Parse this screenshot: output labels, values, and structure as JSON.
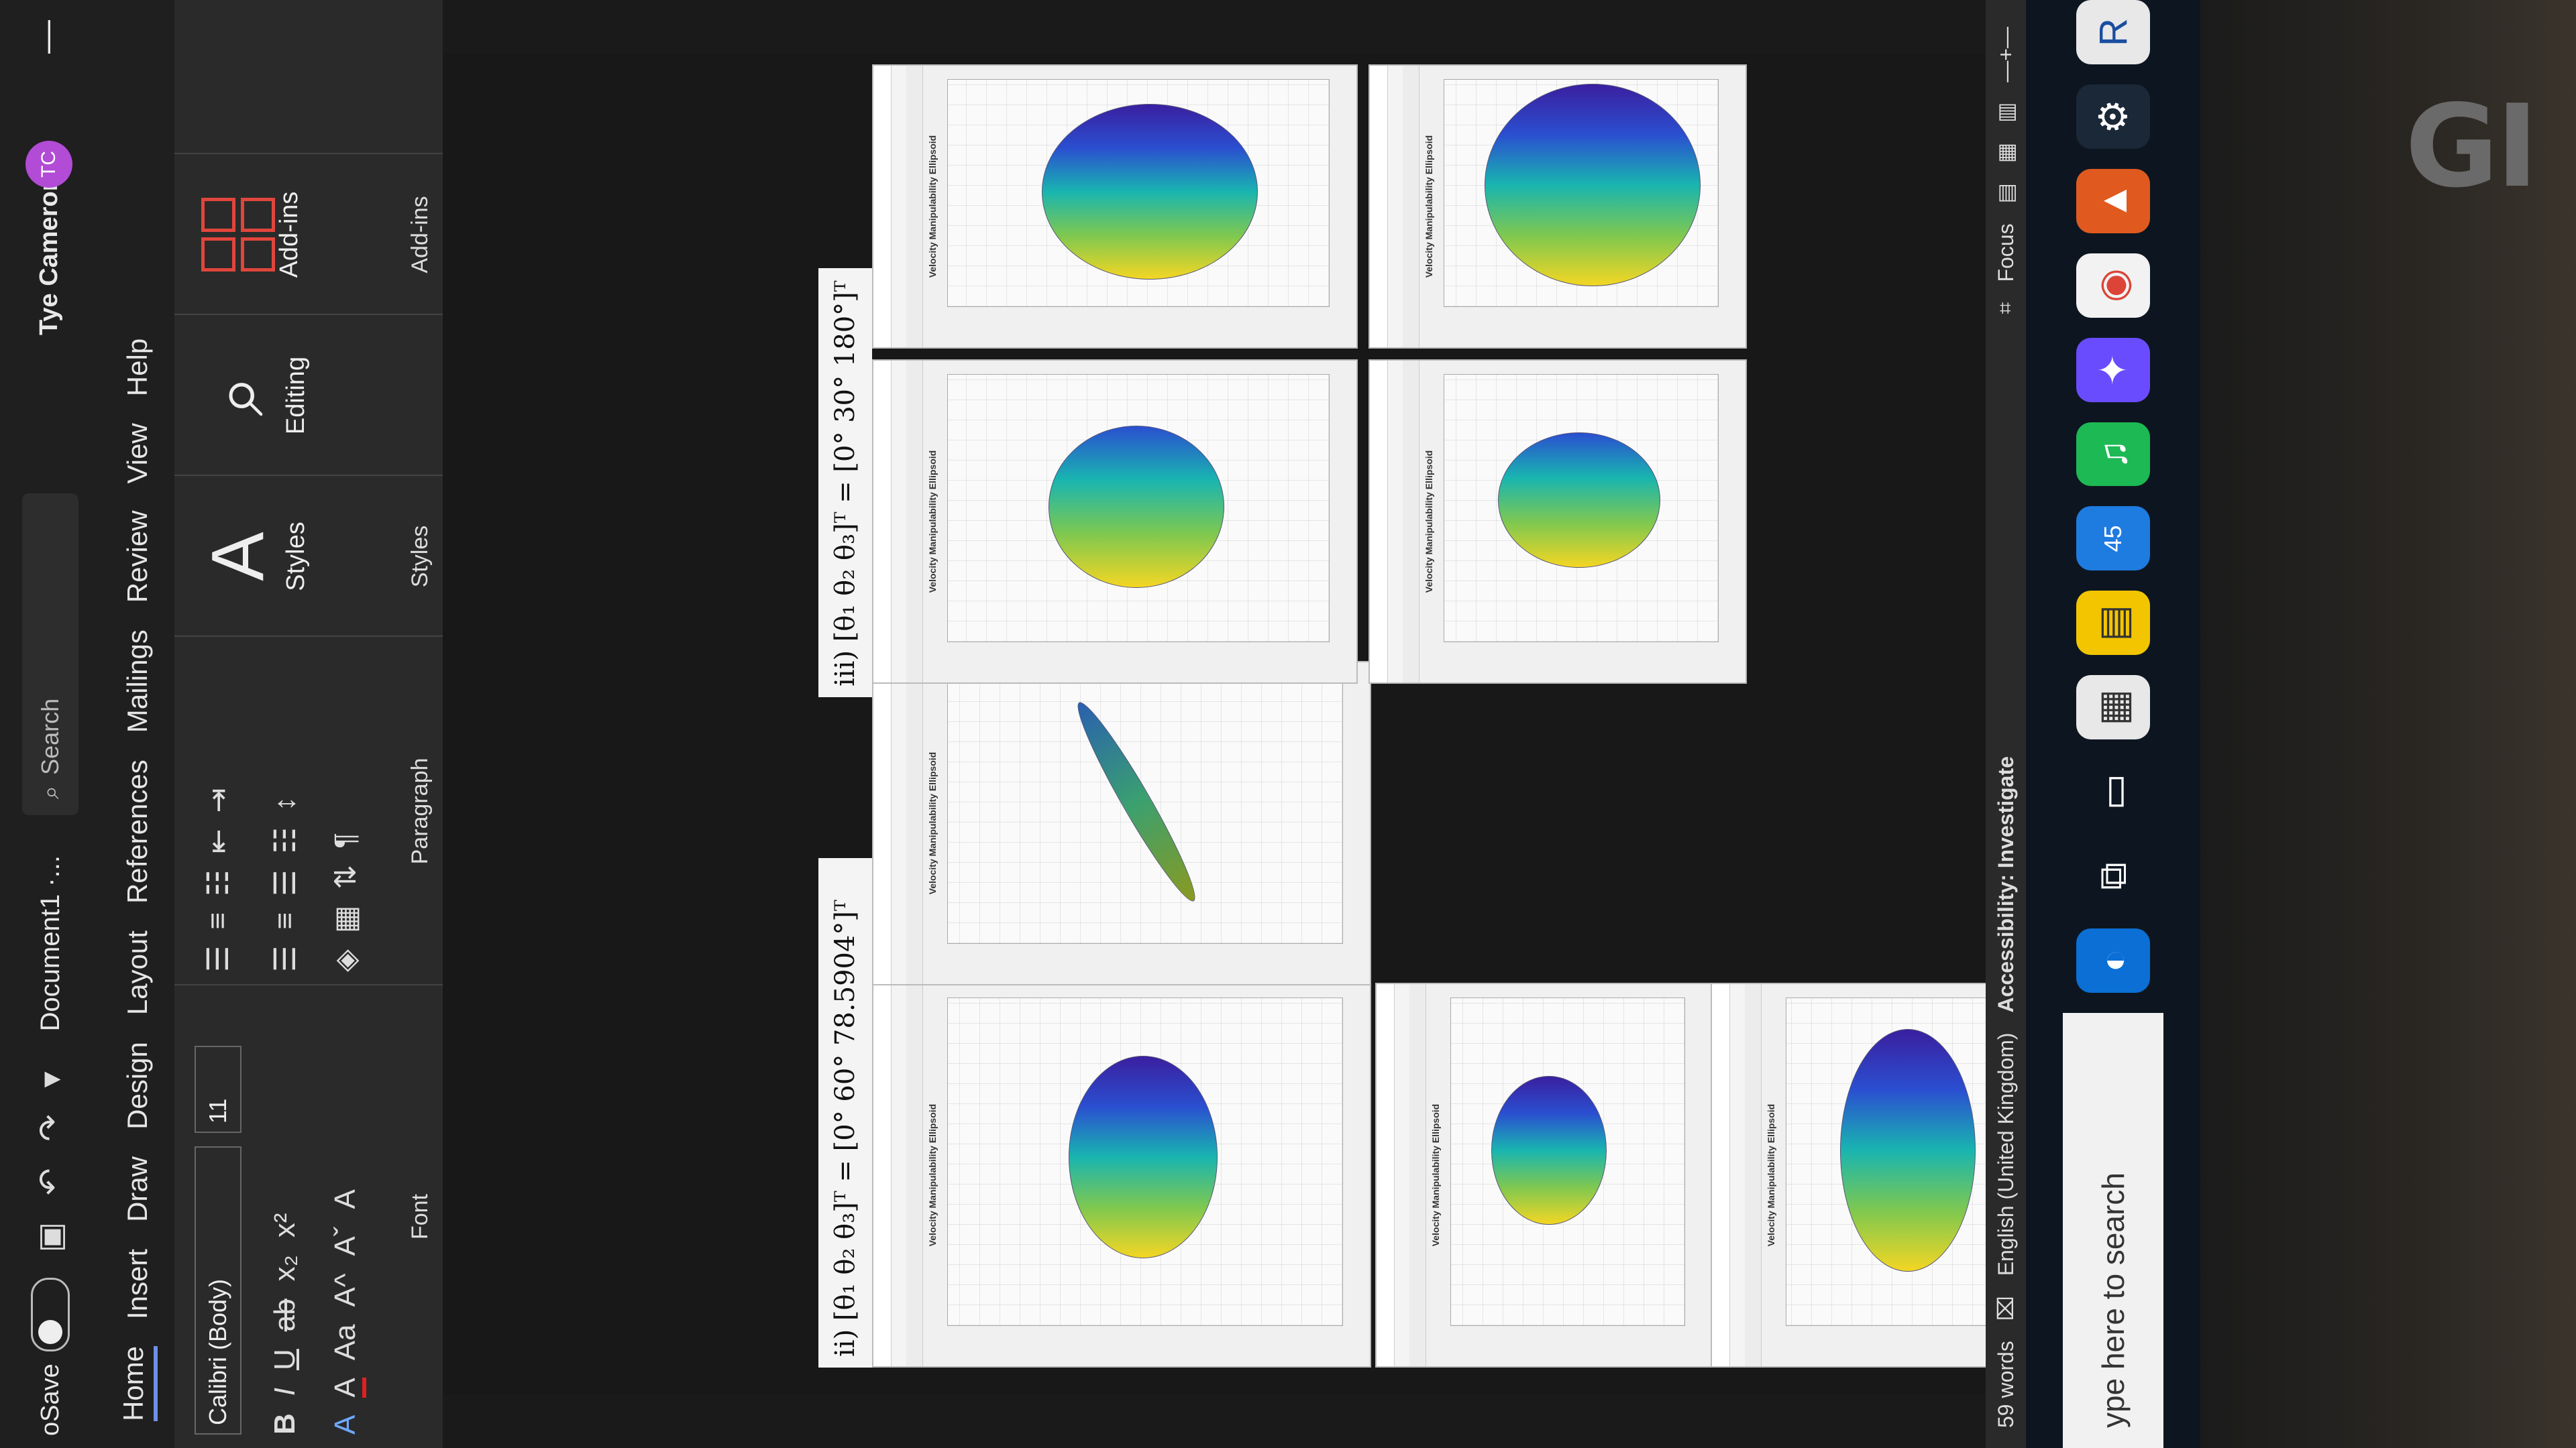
{
  "titlebar": {
    "autosave_label": "oSave",
    "doc_title": "Document1 ·...",
    "search_placeholder": "Search",
    "user_name": "Tye Cameron",
    "user_initials": "TC",
    "minimize": "—"
  },
  "tabs": [
    "Home",
    "Insert",
    "Draw",
    "Design",
    "Layout",
    "References",
    "Mailings",
    "Review",
    "View",
    "Help"
  ],
  "ribbon": {
    "font_name": "Calibri (Body)",
    "font_size": "11",
    "font_group_label": "Font",
    "paragraph_group_label": "Paragraph",
    "styles_label": "Styles",
    "styles_group_label": "Styles",
    "editing_label": "Editing",
    "addins_label": "Add-ins",
    "addins_group_label": "Add-ins",
    "format_buttons": [
      "B",
      "I",
      "U",
      "ab",
      "x₂",
      "x²"
    ],
    "format_row2": [
      "A",
      "A",
      "Aa",
      "A^",
      "Aˇ",
      "A"
    ]
  },
  "document": {
    "equation_ii": "ii) [θ₁  θ₂  θ₃]ᵀ = [0°  60°  78.5904°]ᵀ",
    "equation_iii": "iii) [θ₁  θ₂  θ₃]ᵀ = [0°  30°  180°]ᵀ",
    "figure_title": "Velocity Manipulability Ellipsoid"
  },
  "statusbar": {
    "word_count": "59 words",
    "language": "English (United Kingdom)",
    "accessibility": "Accessibility: Investigate",
    "focus": "Focus"
  },
  "taskbar": {
    "search_placeholder": "ype here to search",
    "mail_badge": "45"
  },
  "bezel": {
    "logo_text": "GI"
  },
  "colors": {
    "accent": "#6f8fe8",
    "avatar": "#b24bd6",
    "addins": "#e0463c"
  }
}
